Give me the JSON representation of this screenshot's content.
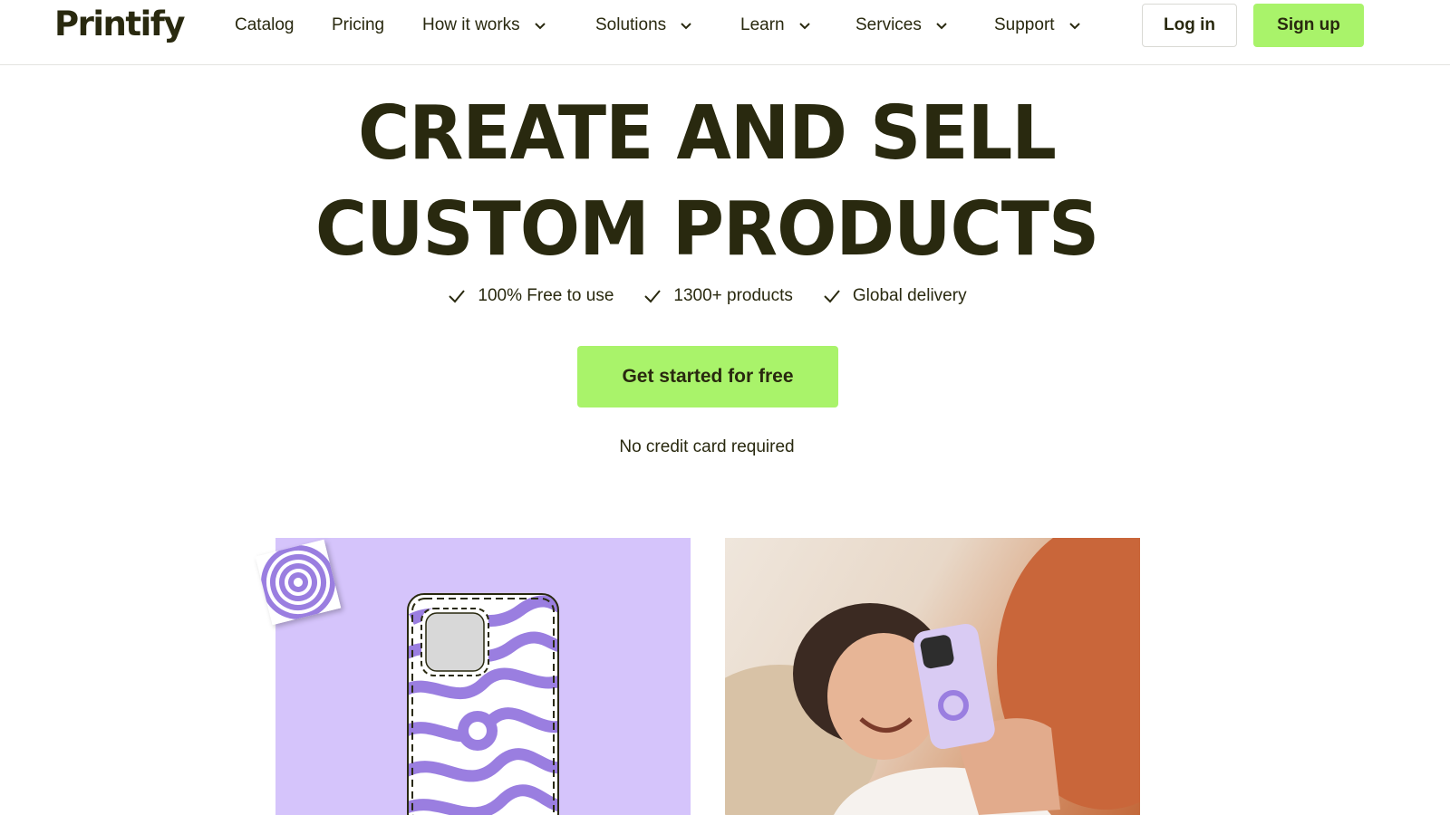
{
  "brand": {
    "logo_text": "Printify"
  },
  "nav": {
    "items": [
      {
        "label": "Catalog",
        "has_dropdown": false
      },
      {
        "label": "Pricing",
        "has_dropdown": false
      },
      {
        "label": "How it works",
        "has_dropdown": true
      },
      {
        "label": "Solutions",
        "has_dropdown": true
      },
      {
        "label": "Learn",
        "has_dropdown": true
      },
      {
        "label": "Services",
        "has_dropdown": true
      },
      {
        "label": "Support",
        "has_dropdown": true
      }
    ],
    "login_label": "Log in",
    "signup_label": "Sign up"
  },
  "hero": {
    "title_line1": "CREATE AND SELL",
    "title_line2": "CUSTOM PRODUCTS",
    "features": [
      {
        "icon": "check-icon",
        "label": "100% Free to use"
      },
      {
        "icon": "check-icon",
        "label": "1300+ products"
      },
      {
        "icon": "check-icon",
        "label": "Global delivery"
      }
    ],
    "cta_label": "Get started for free",
    "cta_note": "No credit card required"
  },
  "colors": {
    "text": "#29290f",
    "accent_green": "#a9f36a",
    "panel_lavender": "#d5c4fb",
    "swirl_purple": "#9a7ee0"
  }
}
